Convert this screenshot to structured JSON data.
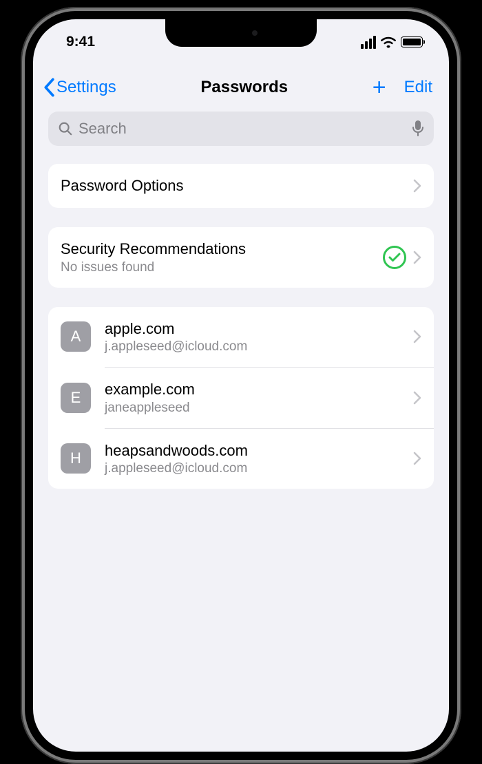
{
  "status": {
    "time": "9:41"
  },
  "nav": {
    "back_label": "Settings",
    "title": "Passwords",
    "edit_label": "Edit"
  },
  "search": {
    "placeholder": "Search"
  },
  "sections": {
    "options_label": "Password Options",
    "security": {
      "title": "Security Recommendations",
      "subtitle": "No issues found"
    }
  },
  "accounts": [
    {
      "letter": "A",
      "site": "apple.com",
      "user": "j.appleseed@icloud.com"
    },
    {
      "letter": "E",
      "site": "example.com",
      "user": "janeappleseed"
    },
    {
      "letter": "H",
      "site": "heapsandwoods.com",
      "user": "j.appleseed@icloud.com"
    }
  ]
}
